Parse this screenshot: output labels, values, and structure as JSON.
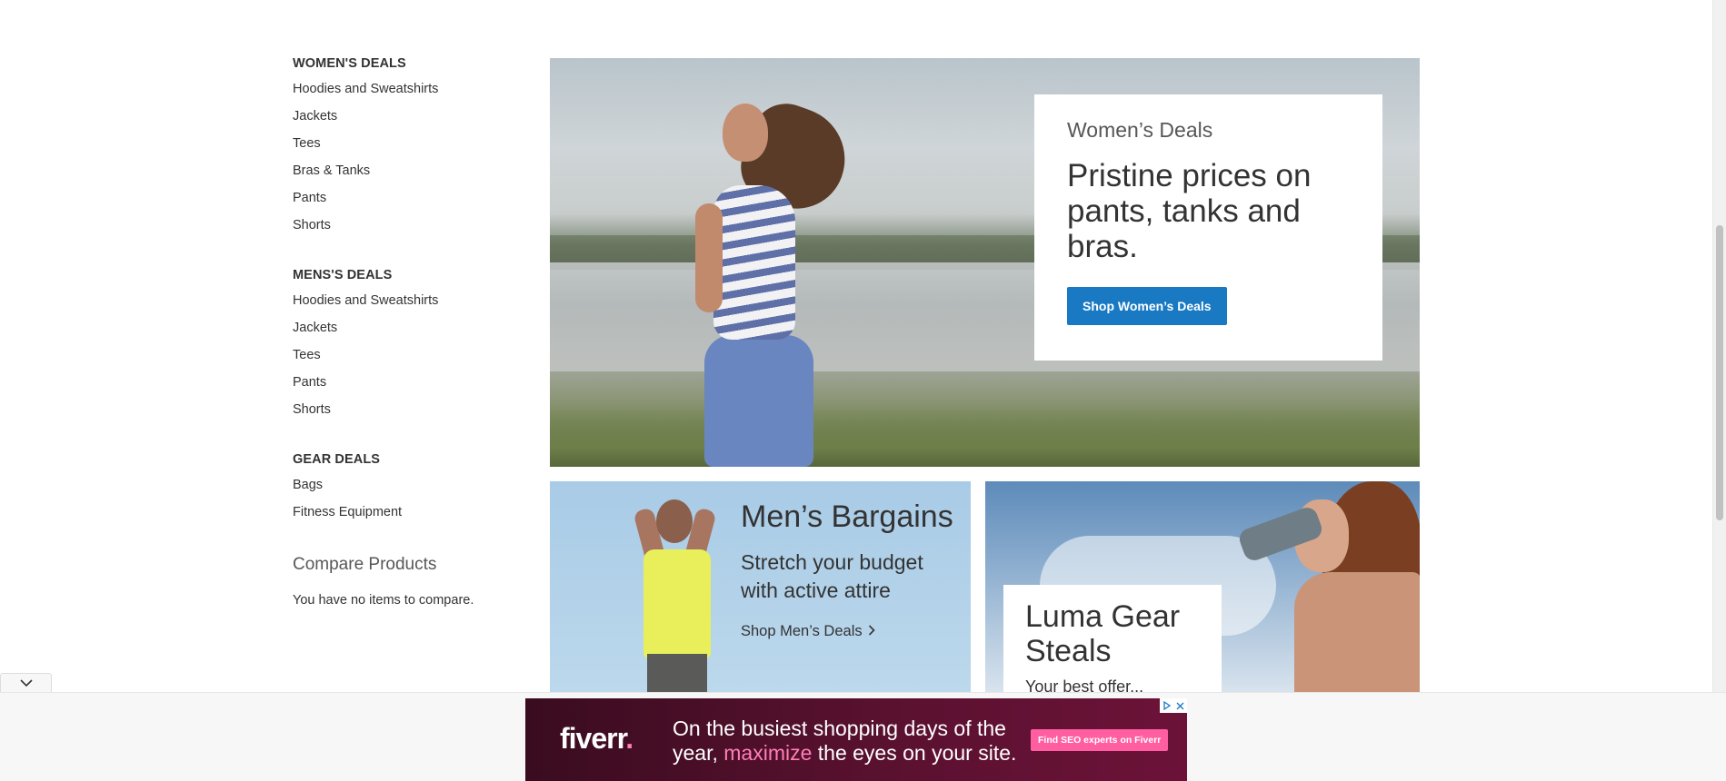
{
  "sidebar": {
    "sections": [
      {
        "title": "WOMEN'S DEALS",
        "items": [
          "Hoodies and Sweatshirts",
          "Jackets",
          "Tees",
          "Bras & Tanks",
          "Pants",
          "Shorts"
        ]
      },
      {
        "title": "MENS'S DEALS",
        "items": [
          "Hoodies and Sweatshirts",
          "Jackets",
          "Tees",
          "Pants",
          "Shorts"
        ]
      },
      {
        "title": "GEAR DEALS",
        "items": [
          "Bags",
          "Fitness Equipment"
        ]
      }
    ],
    "compare": {
      "title": "Compare Products",
      "empty_text": "You have no items to compare."
    }
  },
  "hero": {
    "eyebrow": "Women’s Deals",
    "headline": "Pristine prices on pants, tanks and bras.",
    "button_label": "Shop Women’s Deals"
  },
  "men_block": {
    "title": "Men’s Bargains",
    "subtitle": "Stretch your budget with active attire",
    "link_label": "Shop Men’s Deals"
  },
  "gear_block": {
    "title": "Luma Gear Steals",
    "subtitle": "Your best offer..."
  },
  "ad": {
    "logo_text": "fiverr",
    "logo_dot": ".",
    "message_pre": "On the busiest shopping days of the year, ",
    "message_highlight": "maximize",
    "message_post": " the eyes on your site.",
    "cta_label": "Find SEO experts on Fiverr",
    "icons": [
      "adchoices-icon",
      "close-icon"
    ]
  },
  "colors": {
    "primary_button": "#1979c3",
    "ad_background": "#4a0f27",
    "ad_accent": "#ff7fb7"
  }
}
